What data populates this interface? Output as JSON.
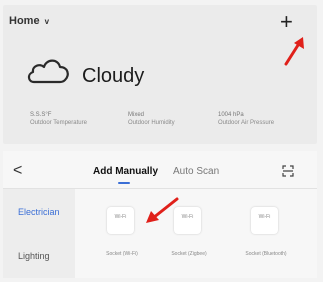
{
  "home": {
    "title": "Home",
    "caret": "v"
  },
  "header": {
    "add_icon": "+"
  },
  "weather": {
    "condition": "Cloudy",
    "stats": [
      {
        "value": "Ѕ.Ѕ.Ѕ°F",
        "label": "Outdoor Temperature"
      },
      {
        "value": "Mixed",
        "label": "Outdoor Humidity"
      },
      {
        "value": "1004 hPa",
        "label": "Outdoor Air Pressure"
      }
    ]
  },
  "add_device": {
    "back_icon": "<",
    "tabs": [
      {
        "label": "Add Manually",
        "active": true
      },
      {
        "label": "Auto Scan",
        "active": false
      }
    ],
    "categories": [
      {
        "label": "Electrician",
        "active": true
      },
      {
        "label": "Lighting",
        "active": false
      }
    ],
    "devices": [
      {
        "icon_text": "Wi-Fi",
        "label": "Socket (Wi-Fi)"
      },
      {
        "icon_text": "Wi-Fi",
        "label": "Socket (Zigbee)"
      },
      {
        "icon_text": "Wi-Fi",
        "label": "Socket (Bluetooth)"
      }
    ]
  },
  "colors": {
    "accent": "#3b6fd6",
    "arrow": "#e0201a"
  }
}
